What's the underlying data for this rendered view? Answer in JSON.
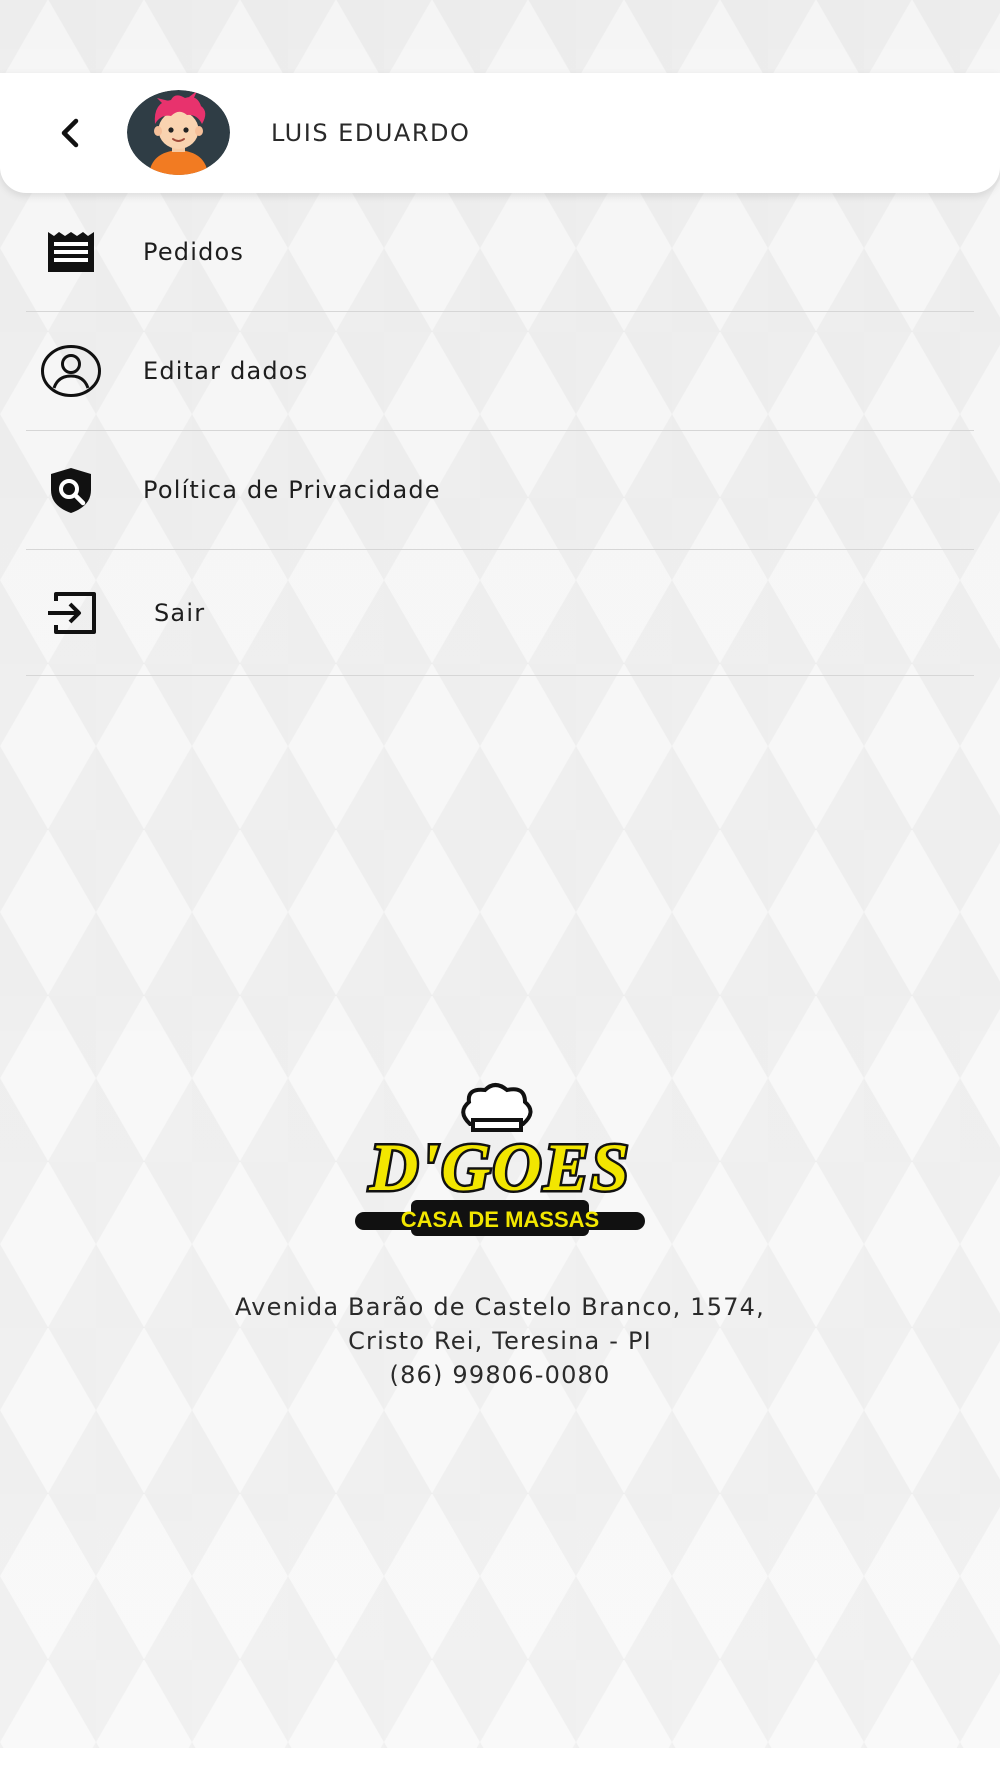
{
  "header": {
    "user_name": "LUIS EDUARDO",
    "back_icon": "chevron-left-icon",
    "avatar_icon": "cartoon-avatar"
  },
  "menu": {
    "items": [
      {
        "label": "Pedidos",
        "icon": "receipt-icon"
      },
      {
        "label": "Editar dados",
        "icon": "user-circle-icon"
      },
      {
        "label": "Política de Privacidade",
        "icon": "shield-search-icon"
      },
      {
        "label": "Sair",
        "icon": "exit-icon"
      }
    ]
  },
  "footer": {
    "logo_text": "D'GOES",
    "logo_subtitle": "CASA DE MASSAS",
    "address_line1": "Avenida Barão de Castelo Branco, 1574,",
    "address_line2": "Cristo Rei, Teresina - PI",
    "phone": "(86) 99806-0080"
  },
  "colors": {
    "background": "#f3f3f3",
    "header": "#ffffff",
    "text": "#1e1e1e",
    "divider": "#d6d6d6",
    "logo_yellow": "#f2e600",
    "logo_black": "#111111",
    "avatar_hair": "#e8326d",
    "avatar_shirt": "#f27b22"
  }
}
